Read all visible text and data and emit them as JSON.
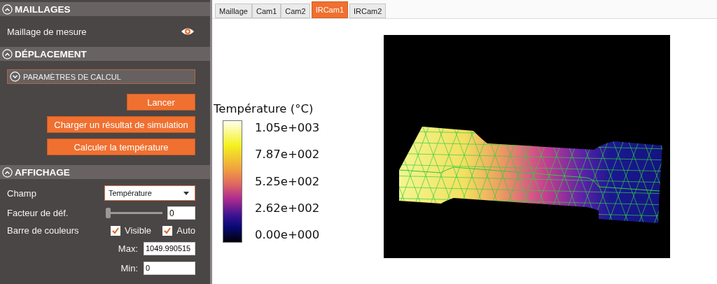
{
  "sidebar": {
    "sections": [
      {
        "kind": "meshes",
        "title": "MAILLAGES",
        "expanded": true,
        "rows": [
          {
            "label": "Maillage de mesure",
            "visible": true
          }
        ]
      },
      {
        "kind": "displacement",
        "title": "DÉPLACEMENT",
        "expanded": true,
        "subsection": {
          "title": "PARAMÈTRES DE CALCUL",
          "expanded": false
        },
        "buttons": [
          {
            "label": "Lancer",
            "kind": "short"
          },
          {
            "label": "Charger un résultat de simulation",
            "kind": "wide"
          },
          {
            "label": "Calculer la température",
            "kind": "wide"
          }
        ]
      },
      {
        "kind": "display",
        "title": "AFFICHAGE",
        "expanded": true,
        "field": {
          "label": "Champ",
          "value": "Température"
        },
        "deformation": {
          "label": "Facteur de déf.",
          "level": 0,
          "value": "0"
        },
        "colorbar": {
          "label": "Barre de couleurs",
          "visible": {
            "label": "Visible",
            "checked": true
          },
          "auto": {
            "label": "Auto",
            "checked": true
          },
          "max": {
            "label": "Max:",
            "value": "1049.990515"
          },
          "min": {
            "label": "Min:",
            "value": "0"
          }
        }
      }
    ]
  },
  "tabs": [
    {
      "label": "Maillage",
      "selected": false
    },
    {
      "label": "Cam1",
      "selected": false
    },
    {
      "label": "Cam2",
      "selected": false
    },
    {
      "label": "IRCam1",
      "selected": true
    },
    {
      "label": "IRCam2",
      "selected": false
    }
  ],
  "viewport": {
    "legend": {
      "title": "Température (°C)",
      "ticks": [
        "1.05e+003",
        "7.87e+002",
        "5.25e+002",
        "2.62e+002",
        "0.00e+000"
      ]
    }
  }
}
